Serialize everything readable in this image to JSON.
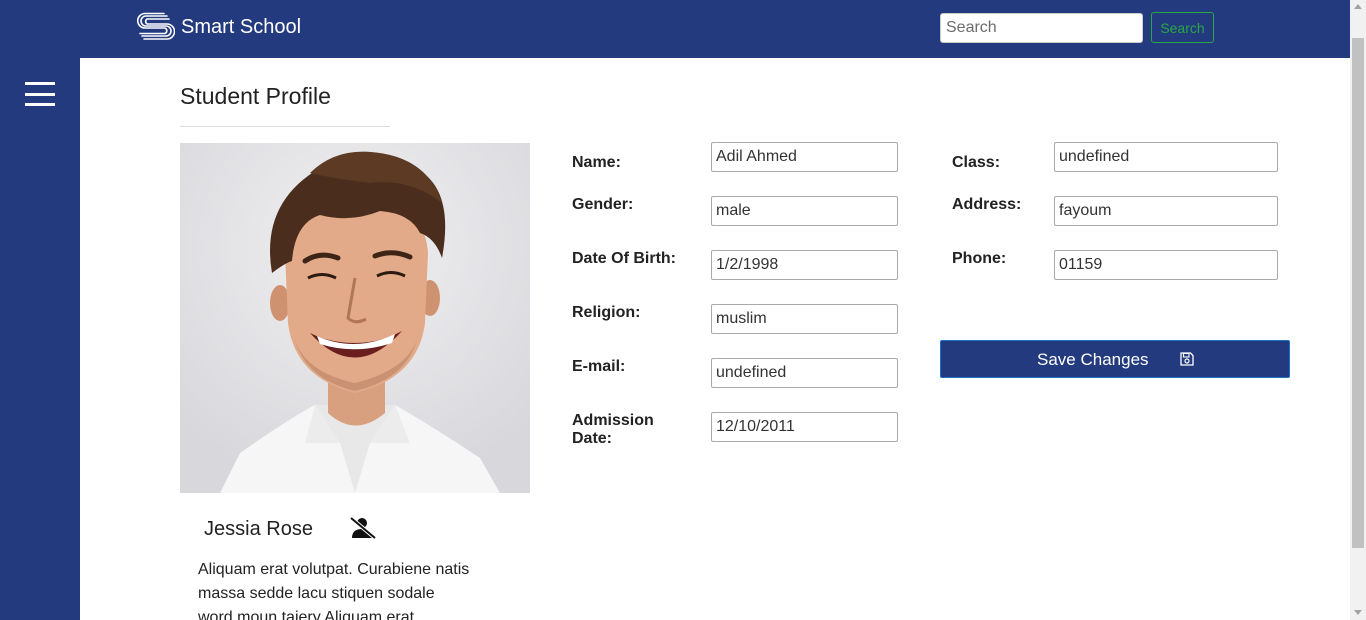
{
  "header": {
    "brand_name": "Smart School",
    "search_placeholder": "Search",
    "search_button": "Search"
  },
  "profile": {
    "title": "Student Profile",
    "student_name": "Jessia Rose",
    "bio": "Aliquam erat volutpat. Curabiene natis massa sedde lacu stiquen sodale word moun taiery Aliquam erat"
  },
  "fields": {
    "name": {
      "label": "Name:",
      "value": "Adil Ahmed"
    },
    "gender": {
      "label": "Gender:",
      "value": "male"
    },
    "dob": {
      "label": "Date Of Birth:",
      "value": "1/2/1998"
    },
    "religion": {
      "label": "Religion:",
      "value": "muslim"
    },
    "email": {
      "label": "E-mail:",
      "value": "undefined"
    },
    "admission": {
      "label": "Admission Date:",
      "value": "12/10/2011"
    },
    "class": {
      "label": "Class:",
      "value": "undefined"
    },
    "address": {
      "label": "Address:",
      "value": "fayoum"
    },
    "phone": {
      "label": "Phone:",
      "value": "01159"
    }
  },
  "actions": {
    "save_label": "Save Changes"
  },
  "colors": {
    "brand": "#233a7e",
    "search_button": "#28a745",
    "save_border": "#1a73c8"
  },
  "icons": {
    "logo": "brand-logo-icon",
    "menu": "hamburger-menu-icon",
    "user": "user-slash-icon",
    "save": "floppy-disk-icon"
  }
}
